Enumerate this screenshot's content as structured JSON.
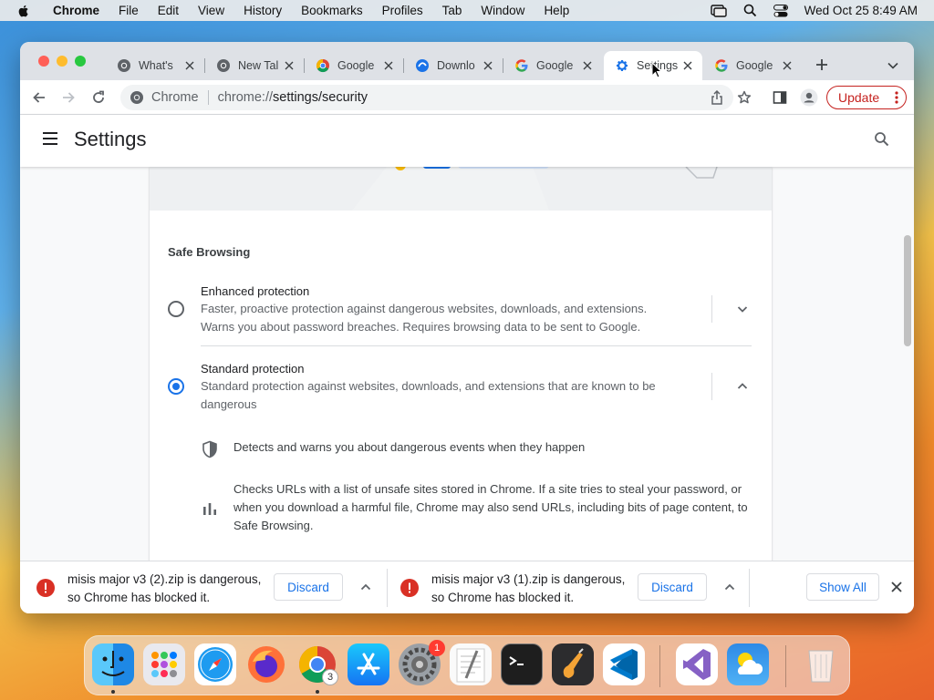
{
  "menubar": {
    "app_name": "Chrome",
    "items": [
      "File",
      "Edit",
      "View",
      "History",
      "Bookmarks",
      "Profiles",
      "Tab",
      "Window",
      "Help"
    ],
    "datetime": "Wed Oct 25  8:49 AM"
  },
  "tabs": [
    {
      "title": "What's",
      "icon": "chrome-icon"
    },
    {
      "title": "New Tal",
      "icon": "chrome-icon"
    },
    {
      "title": "Google",
      "icon": "chrome-color-icon"
    },
    {
      "title": "Downlo",
      "icon": "download-icon"
    },
    {
      "title": "Google",
      "icon": "google-icon"
    },
    {
      "title": "Settings",
      "icon": "gear-icon",
      "active": true
    },
    {
      "title": "Google",
      "icon": "google-icon"
    }
  ],
  "omnibox": {
    "chip_label": "Chrome",
    "url_host": "chrome://",
    "url_path": "settings/security"
  },
  "update_label": "Update",
  "settings": {
    "title": "Settings",
    "section_title": "Safe Browsing",
    "options": [
      {
        "label": "Enhanced protection",
        "description": "Faster, proactive protection against dangerous websites, downloads, and extensions. Warns you about password breaches. Requires browsing data to be sent to Google.",
        "checked": false
      },
      {
        "label": "Standard protection",
        "description": "Standard protection against websites, downloads, and extensions that are known to be dangerous",
        "checked": true
      }
    ],
    "details": [
      {
        "icon": "shield-icon",
        "text": "Detects and warns you about dangerous events when they happen"
      },
      {
        "icon": "bar-chart-icon",
        "text": "Checks URLs with a list of unsafe sites stored in Chrome. If a site tries to steal your password, or when you download a harmful file, Chrome may also send URLs, including bits of page content, to Safe Browsing."
      }
    ]
  },
  "downloads": [
    {
      "text": "misis major v3 (2).zip is dangerous, so Chrome has blocked it.",
      "button": "Discard"
    },
    {
      "text": "misis major v3 (1).zip is dangerous, so Chrome has blocked it.",
      "button": "Discard"
    }
  ],
  "show_all_label": "Show All",
  "dock": {
    "settings_badge": "1",
    "chrome_badge": "3"
  },
  "colors": {
    "accent": "#1a73e8",
    "update": "#c5221f",
    "danger": "#d93025"
  }
}
